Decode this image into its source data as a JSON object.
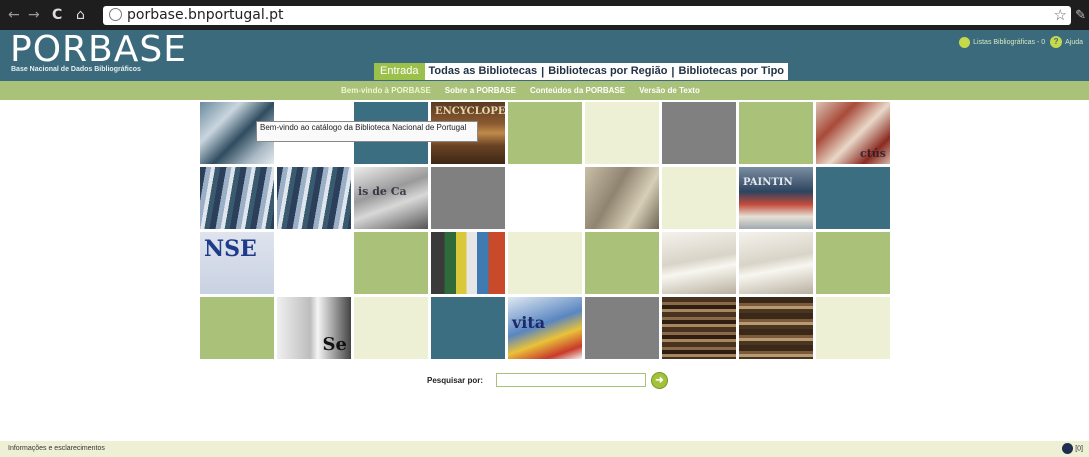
{
  "browser": {
    "url": "porbase.bnportugal.pt",
    "nav_back": "←",
    "nav_forward": "→",
    "reload": "C",
    "home": "⌂",
    "star": "☆",
    "menu": "✎"
  },
  "header": {
    "logo": "PORBASE",
    "subtitle": "Base Nacional de Dados Bibliográficos",
    "lists_link": "Listas Bibliográficas - 0",
    "help_link": "Ajuda",
    "help_glyph": "?"
  },
  "main_tabs": [
    {
      "label": "Entrada",
      "active": true
    },
    {
      "label": "Todas as Bibliotecas"
    },
    {
      "label": "Bibliotecas por Região"
    },
    {
      "label": "Bibliotecas por Tipo"
    }
  ],
  "sub_nav": [
    {
      "label": "Bem-vindo à PORBASE",
      "active": true
    },
    {
      "label": "Sobre a PORBASE"
    },
    {
      "label": "Conteúdos da PORBASE"
    },
    {
      "label": "Versão de Texto"
    }
  ],
  "tooltip": "Bem-vindo ao catálogo da Biblioteca Nacional de Portugal",
  "tile_text": {
    "ency": "ENCYCLOPE",
    "script": "ctús",
    "print": "is de Ca",
    "paint": "PAINTIN",
    "nse": "NSE",
    "news": "Se",
    "vita": "vita"
  },
  "search": {
    "label": "Pesquisar por:",
    "value": "",
    "placeholder": "",
    "go_glyph": "➜"
  },
  "footer": {
    "info": "Informações e esclarecimentos",
    "counter": "[0]"
  },
  "colors": {
    "header_teal": "#3a6a7b",
    "accent_green": "#a9c179",
    "tab_active": "#9cc04c",
    "cream": "#eef0d5"
  }
}
